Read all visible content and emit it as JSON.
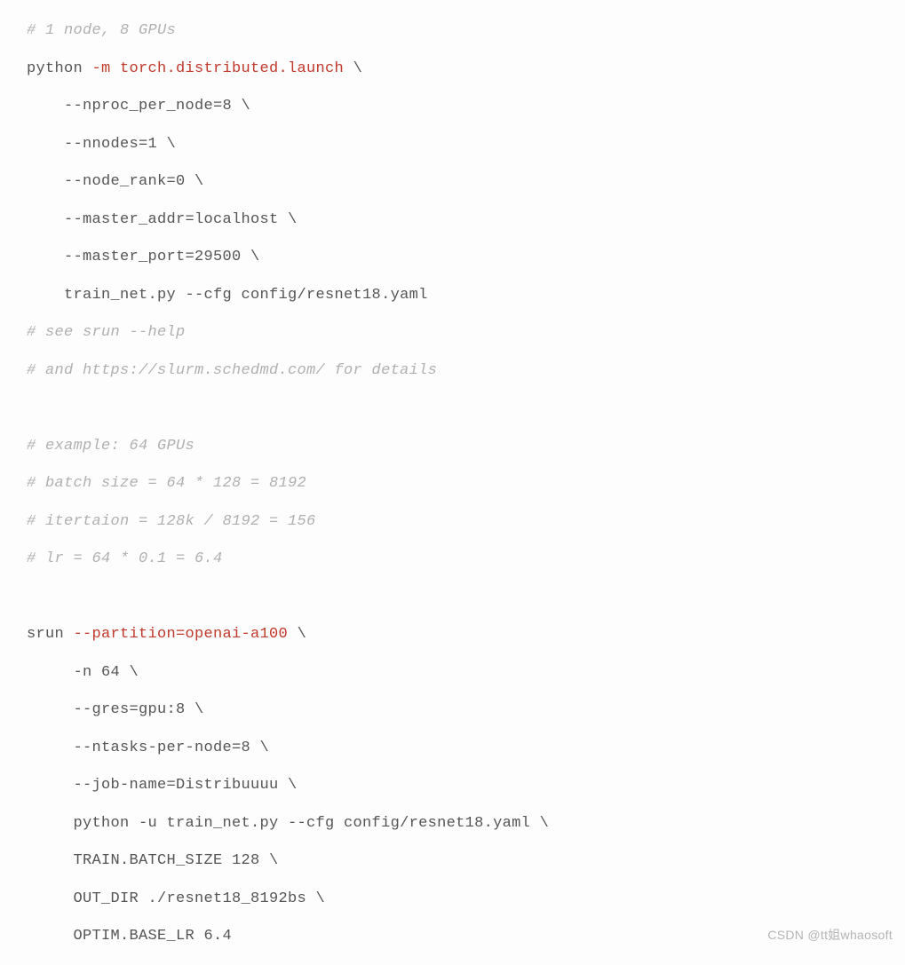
{
  "code": {
    "lines": [
      {
        "segments": [
          {
            "cls": "comment",
            "text": "# 1 node, 8 GPUs"
          }
        ]
      },
      {
        "segments": [
          {
            "cls": "plain",
            "text": "python "
          },
          {
            "cls": "arg",
            "text": "-m torch.distributed.launch"
          },
          {
            "cls": "plain",
            "text": " \\"
          }
        ]
      },
      {
        "segments": [
          {
            "cls": "plain",
            "text": "    --nproc_per_node=8 \\"
          }
        ]
      },
      {
        "segments": [
          {
            "cls": "plain",
            "text": "    --nnodes=1 \\"
          }
        ]
      },
      {
        "segments": [
          {
            "cls": "plain",
            "text": "    --node_rank=0 \\"
          }
        ]
      },
      {
        "segments": [
          {
            "cls": "plain",
            "text": "    --master_addr=localhost \\"
          }
        ]
      },
      {
        "segments": [
          {
            "cls": "plain",
            "text": "    --master_port=29500 \\"
          }
        ]
      },
      {
        "segments": [
          {
            "cls": "plain",
            "text": "    train_net.py --cfg config/resnet18.yaml"
          }
        ]
      },
      {
        "segments": [
          {
            "cls": "comment",
            "text": "# see srun --help"
          }
        ]
      },
      {
        "segments": [
          {
            "cls": "comment",
            "text": "# and https://slurm.schedmd.com/ for details"
          }
        ]
      },
      {
        "segments": [
          {
            "cls": "plain",
            "text": ""
          }
        ]
      },
      {
        "segments": [
          {
            "cls": "comment",
            "text": "# example: 64 GPUs"
          }
        ]
      },
      {
        "segments": [
          {
            "cls": "comment",
            "text": "# batch size = 64 * 128 = 8192"
          }
        ]
      },
      {
        "segments": [
          {
            "cls": "comment",
            "text": "# itertaion = 128k / 8192 = 156"
          }
        ]
      },
      {
        "segments": [
          {
            "cls": "comment",
            "text": "# lr = 64 * 0.1 = 6.4"
          }
        ]
      },
      {
        "segments": [
          {
            "cls": "plain",
            "text": ""
          }
        ]
      },
      {
        "segments": [
          {
            "cls": "plain",
            "text": "srun "
          },
          {
            "cls": "arg",
            "text": "--partition=openai-a100"
          },
          {
            "cls": "plain",
            "text": " \\"
          }
        ]
      },
      {
        "segments": [
          {
            "cls": "plain",
            "text": "     -n 64 \\"
          }
        ]
      },
      {
        "segments": [
          {
            "cls": "plain",
            "text": "     --gres=gpu:8 \\"
          }
        ]
      },
      {
        "segments": [
          {
            "cls": "plain",
            "text": "     --ntasks-per-node=8 \\"
          }
        ]
      },
      {
        "segments": [
          {
            "cls": "plain",
            "text": "     --job-name=Distribuuuu \\"
          }
        ]
      },
      {
        "segments": [
          {
            "cls": "plain",
            "text": "     python -u train_net.py --cfg config/resnet18.yaml \\"
          }
        ]
      },
      {
        "segments": [
          {
            "cls": "plain",
            "text": "     TRAIN.BATCH_SIZE 128 \\"
          }
        ]
      },
      {
        "segments": [
          {
            "cls": "plain",
            "text": "     OUT_DIR ./resnet18_8192bs \\"
          }
        ]
      },
      {
        "segments": [
          {
            "cls": "plain",
            "text": "     OPTIM.BASE_LR 6.4"
          }
        ]
      }
    ]
  },
  "watermark": {
    "front": "CSDN @tt姐whaosoft",
    "back": ""
  }
}
